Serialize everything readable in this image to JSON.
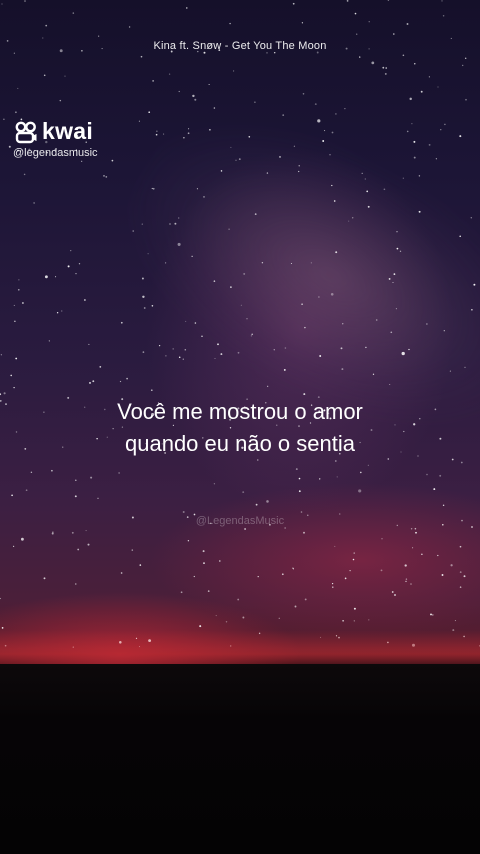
{
  "video": {
    "song_title": "Kina ft. Snøw - Get You The Moon",
    "brand": {
      "name": "kwai",
      "icon": "kwai-logo-icon"
    },
    "handle": "@legendasmusic",
    "lyrics": [
      "Você me mostrou o amor",
      "quando eu não o sentia"
    ],
    "watermark": "@LegendasMusic",
    "moon_icon": "crescent-moon-icon"
  },
  "colors": {
    "sky_top": "#15102a",
    "sky_mid": "#3b1f43",
    "horizon": "#c82d32",
    "ground": "#060406",
    "text": "#ffffff"
  }
}
